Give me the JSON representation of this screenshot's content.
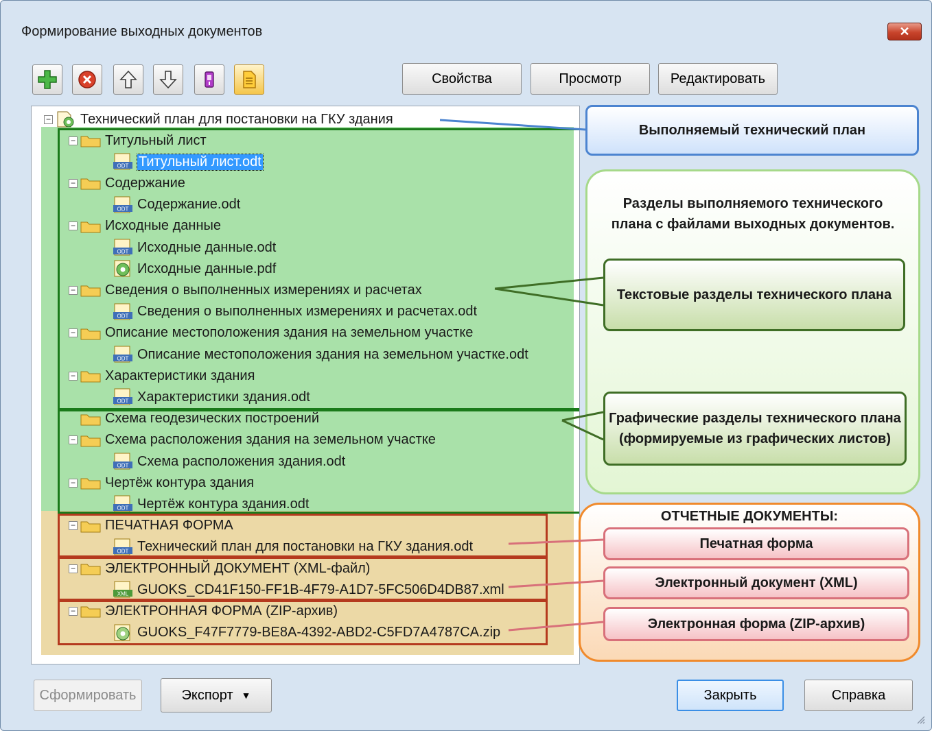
{
  "window": {
    "title": "Формирование выходных документов",
    "close_glyph": "✕"
  },
  "toolbar": {
    "icons": [
      "add-icon",
      "delete-icon",
      "arrow-up-icon",
      "arrow-down-icon",
      "usb-export-icon",
      "document-icon"
    ],
    "properties_label": "Свойства",
    "preview_label": "Просмотр",
    "edit_label": "Редактировать"
  },
  "tree": {
    "root": "Технический план для постановки на ГКУ здания",
    "rows": [
      {
        "label": "Титульный лист",
        "kind": "folder",
        "level": 1
      },
      {
        "label": "Титульный лист.odt",
        "kind": "odt",
        "level": 2,
        "selected": true
      },
      {
        "label": "Содержание",
        "kind": "folder",
        "level": 1
      },
      {
        "label": "Содержание.odt",
        "kind": "odt",
        "level": 2
      },
      {
        "label": "Исходные данные",
        "kind": "folder",
        "level": 1
      },
      {
        "label": "Исходные данные.odt",
        "kind": "odt",
        "level": 2
      },
      {
        "label": "Исходные данные.pdf",
        "kind": "pdf",
        "level": 2
      },
      {
        "label": "Сведения о выполненных измерениях и расчетах",
        "kind": "folder",
        "level": 1
      },
      {
        "label": "Сведения о выполненных измерениях и расчетах.odt",
        "kind": "odt",
        "level": 2
      },
      {
        "label": "Описание местоположения здания на земельном участке",
        "kind": "folder",
        "level": 1
      },
      {
        "label": "Описание местоположения здания на земельном участке.odt",
        "kind": "odt",
        "level": 2
      },
      {
        "label": "Характеристики здания",
        "kind": "folder",
        "level": 1
      },
      {
        "label": "Характеристики здания.odt",
        "kind": "odt",
        "level": 2
      },
      {
        "label": "Схема геодезических построений",
        "kind": "folder",
        "level": 1,
        "no_expander": true
      },
      {
        "label": "Схема расположения здания на земельном участке",
        "kind": "folder",
        "level": 1
      },
      {
        "label": "Схема расположения здания.odt",
        "kind": "odt",
        "level": 2
      },
      {
        "label": "Чертёж контура здания",
        "kind": "folder",
        "level": 1
      },
      {
        "label": "Чертёж контура здания.odt",
        "kind": "odt",
        "level": 2
      },
      {
        "label": "ПЕЧАТНАЯ ФОРМА",
        "kind": "folder",
        "level": 1
      },
      {
        "label": "Технический план для постановки на ГКУ здания.odt",
        "kind": "odt",
        "level": 2
      },
      {
        "label": "ЭЛЕКТРОННЫЙ ДОКУМЕНТ (XML-файл)",
        "kind": "folder",
        "level": 1
      },
      {
        "label": "GUOKS_CD41F150-FF1B-4F79-A1D7-5FC506D4DB87.xml",
        "kind": "xml",
        "level": 2
      },
      {
        "label": "ЭЛЕКТРОННАЯ ФОРМА (ZIP-архив)",
        "kind": "folder",
        "level": 1
      },
      {
        "label": "GUOKS_F47F7779-BE8A-4392-ABD2-C5FD7A4787CA.zip",
        "kind": "zip",
        "level": 2
      }
    ]
  },
  "callouts": {
    "plan": "Выполняемый технический план",
    "sections": "Разделы выполняемого технического плана с файлами выходных документов.",
    "text_sections": "Текстовые разделы технического плана",
    "graphic_sections": "Графические разделы технического плана (формируемые из графических листов)",
    "reports_title": "ОТЧЕТНЫЕ ДОКУМЕНТЫ:",
    "print_form": "Печатная форма",
    "xml_doc": "Электронный документ (XML)",
    "zip_form": "Электронная форма (ZIP-архив)"
  },
  "bottom": {
    "generate_label": "Сформировать",
    "export_label": "Экспорт",
    "export_arrow": "▼",
    "close_label": "Закрыть",
    "help_label": "Справка"
  },
  "colors": {
    "green_highlight": "#a9e1a9",
    "tan_highlight": "#ecd9a6",
    "green_border": "#1a7a1a",
    "red_border": "#b53a1e",
    "selection": "#3399ff"
  }
}
